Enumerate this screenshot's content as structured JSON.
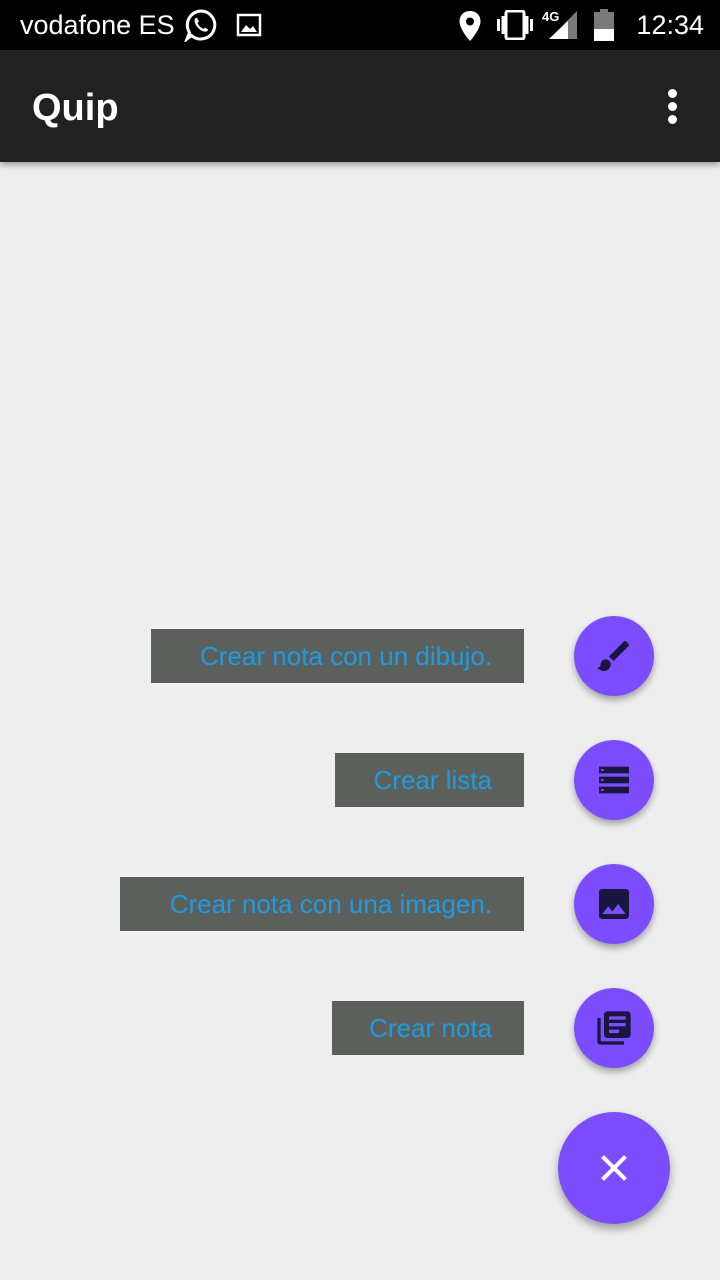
{
  "status_bar": {
    "carrier": "vodafone ES",
    "network": "4G",
    "time": "12:34",
    "icons": [
      "whatsapp-icon",
      "image-notification-icon",
      "location-icon",
      "vibrate-icon",
      "signal-icon",
      "battery-icon"
    ]
  },
  "app_bar": {
    "title": "Quip",
    "overflow_icon": "more-vert-icon"
  },
  "fab_menu": {
    "items": [
      {
        "label": "Crear nota con un dibujo.",
        "icon": "brush-icon"
      },
      {
        "label": "Crear lista",
        "icon": "list-icon"
      },
      {
        "label": "Crear nota con una imagen.",
        "icon": "image-icon"
      },
      {
        "label": "Crear nota",
        "icon": "library-books-icon"
      }
    ],
    "close_icon": "close-icon"
  },
  "colors": {
    "status_bar": "#000000",
    "app_bar": "#212121",
    "background": "#eeeeee",
    "fab": "#7c4dff",
    "fab_icon": "#1a1640",
    "label_background": "#5c605c",
    "label_text": "#1e9be0"
  }
}
